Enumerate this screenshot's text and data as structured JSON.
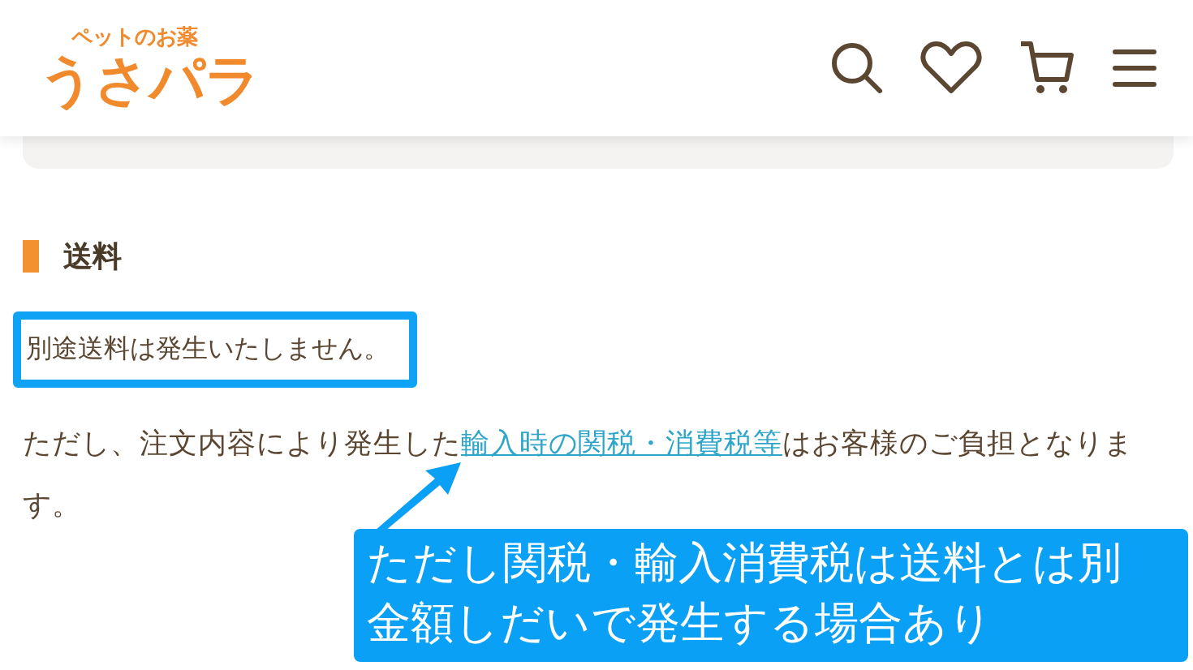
{
  "header": {
    "logo": {
      "tagline": "ペットのお薬",
      "name": "うさパラ"
    }
  },
  "section": {
    "title": "送料",
    "highlight_note": "別途送料は発生いたしません。",
    "paragraph": {
      "before": "ただし、注文内容により発生した",
      "link": "輸入時の関税・消費税等",
      "after": "はお客様のご負担となります。"
    }
  },
  "callout": {
    "line_1": "ただし関税・輸入消費税は送料とは別",
    "line_2": "金額しだいで発生する場合あり"
  }
}
